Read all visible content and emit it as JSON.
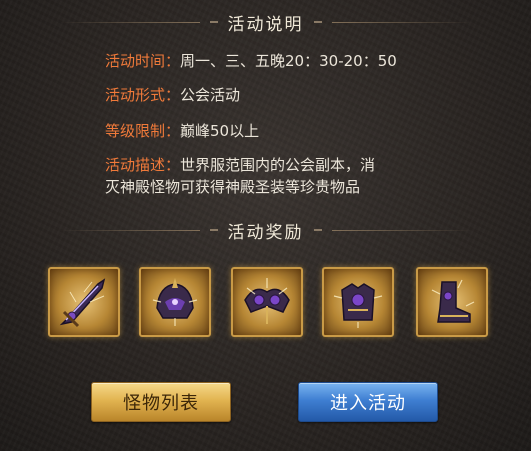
{
  "activity_info": {
    "section_title": "活动说明",
    "time_label": "活动时间：",
    "time_value": "周一、三、五晚20：30-20：50",
    "form_label": "活动形式：",
    "form_value": "公会活动",
    "level_label": "等级限制：",
    "level_value": "巅峰50以上",
    "desc_label": "活动描述：",
    "desc_line1": "世界服范围内的公会副本，消",
    "desc_line2": "灭神殿怪物可获得神殿圣装等珍贵物品"
  },
  "rewards": {
    "section_title": "活动奖励",
    "items": [
      {
        "icon": "sword-icon"
      },
      {
        "icon": "helmet-icon"
      },
      {
        "icon": "shoulder-armor-icon"
      },
      {
        "icon": "chest-armor-icon"
      },
      {
        "icon": "boots-icon"
      }
    ]
  },
  "buttons": {
    "monster_list": "怪物列表",
    "enter_activity": "进入活动"
  },
  "colors": {
    "label_orange": "#f07a3a",
    "gold_button": "#e2b451",
    "blue_button": "#3f7fd2"
  }
}
